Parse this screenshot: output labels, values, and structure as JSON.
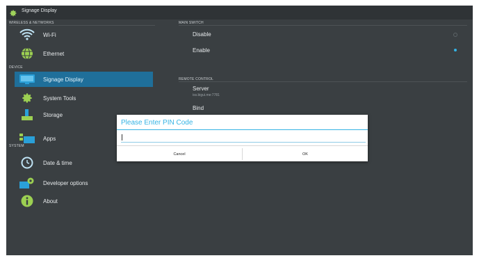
{
  "window": {
    "title": "Signage Display",
    "icon": "gear-icon"
  },
  "sidebar": {
    "sections": [
      "WIRELESS & NETWORKS",
      "DEVICE",
      "SYSTEM"
    ],
    "items": [
      {
        "label": "Wi-Fi",
        "icon": "wifi-icon"
      },
      {
        "label": "Ethernet",
        "icon": "globe-icon"
      },
      {
        "label": "Signage Display",
        "icon": "display-icon",
        "selected": true
      },
      {
        "label": "System Tools",
        "icon": "gear-icon"
      },
      {
        "label": "Storage",
        "icon": "storage-icon"
      },
      {
        "label": "Apps",
        "icon": "apps-icon"
      },
      {
        "label": "Date & time",
        "icon": "clock-icon"
      },
      {
        "label": "Developer options",
        "icon": "developer-icon"
      },
      {
        "label": "About",
        "icon": "info-icon"
      }
    ]
  },
  "main": {
    "main_switch": {
      "header": "MAIN SWITCH",
      "options": [
        {
          "label": "Disable",
          "selected": false
        },
        {
          "label": "Enable",
          "selected": true
        }
      ]
    },
    "remote_control": {
      "header": "REMOTE CONTROL",
      "server": {
        "label": "Server",
        "value": "iss.bigui.me:7781"
      },
      "bind": {
        "label": "Bind"
      }
    }
  },
  "dialog": {
    "title": "Please Enter PIN Code",
    "input_value": "",
    "cancel_label": "Cancel",
    "ok_label": "OK"
  },
  "colors": {
    "accent": "#34b3e4",
    "selected_bg": "#1f6f9a",
    "background": "#3a3f42"
  }
}
